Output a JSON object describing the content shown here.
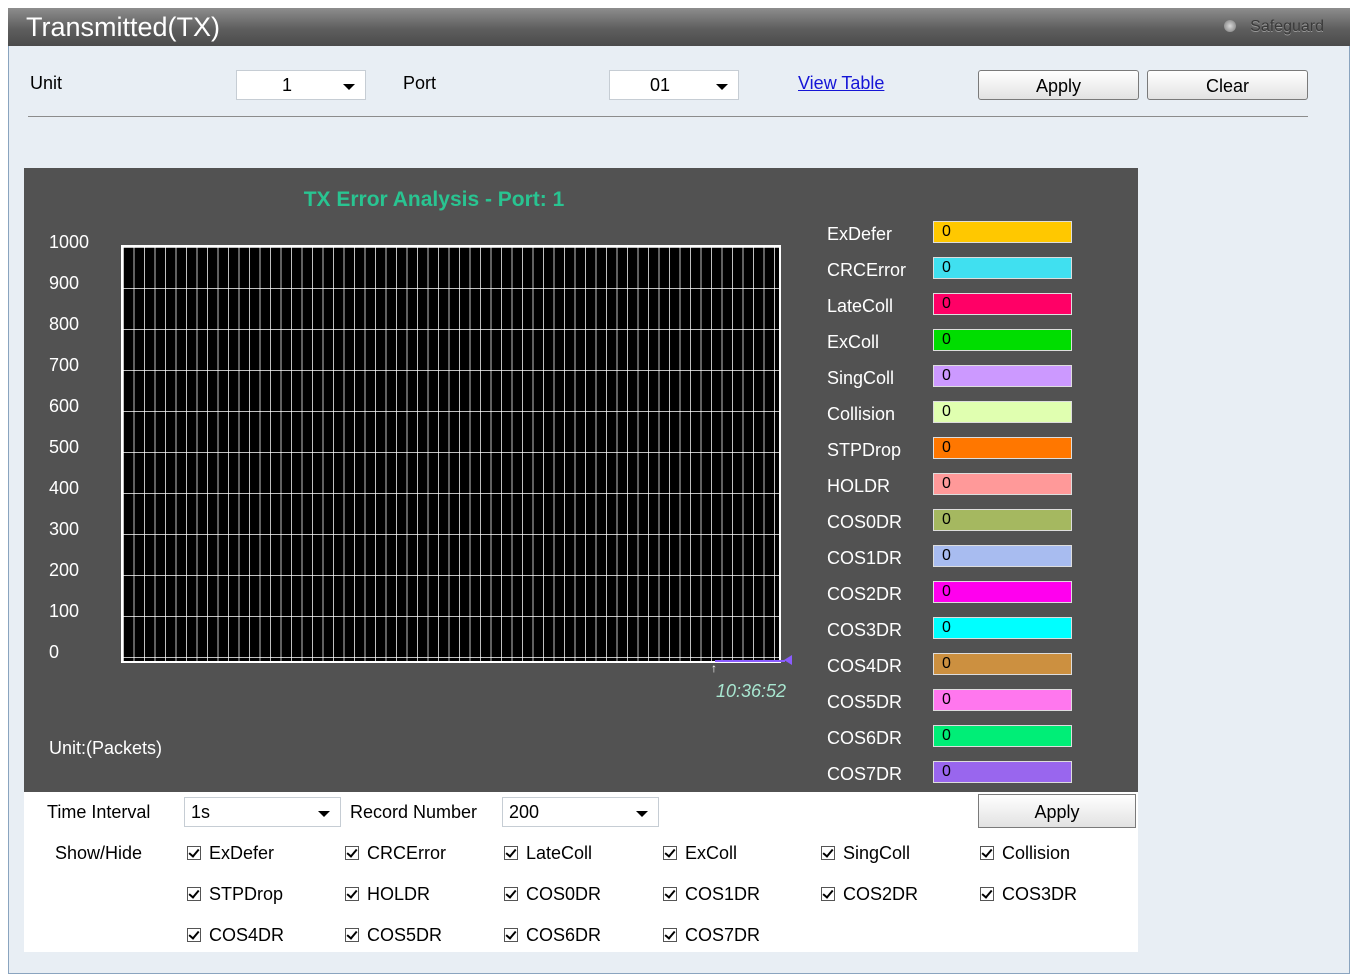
{
  "window": {
    "title": "Transmitted(TX)",
    "safeguard_label": "Safeguard"
  },
  "filters": {
    "unit_label": "Unit",
    "unit_value": "1",
    "port_label": "Port",
    "port_value": "01",
    "view_table_label": "View Table",
    "apply_label": "Apply",
    "clear_label": "Clear"
  },
  "chart": {
    "title": "TX Error Analysis - Port: 1",
    "unit_label": "Unit:(Packets)",
    "timestamp": "10:36:52",
    "y_ticks": [
      "1000",
      "900",
      "800",
      "700",
      "600",
      "500",
      "400",
      "300",
      "200",
      "100",
      "0"
    ],
    "legend": [
      {
        "name": "ExDefer",
        "value": "0",
        "color": "#ffc800"
      },
      {
        "name": "CRCError",
        "value": "0",
        "color": "#40e0f0"
      },
      {
        "name": "LateColl",
        "value": "0",
        "color": "#ff0066"
      },
      {
        "name": "ExColl",
        "value": "0",
        "color": "#00dd00"
      },
      {
        "name": "SingColl",
        "value": "0",
        "color": "#cc99ff"
      },
      {
        "name": "Collision",
        "value": "0",
        "color": "#e0ffb0"
      },
      {
        "name": "STPDrop",
        "value": "0",
        "color": "#ff7700"
      },
      {
        "name": "HOLDR",
        "value": "0",
        "color": "#ff9999"
      },
      {
        "name": "COS0DR",
        "value": "0",
        "color": "#a5b860"
      },
      {
        "name": "COS1DR",
        "value": "0",
        "color": "#a8bcf0"
      },
      {
        "name": "COS2DR",
        "value": "0",
        "color": "#ff00ee"
      },
      {
        "name": "COS3DR",
        "value": "0",
        "color": "#00ffff"
      },
      {
        "name": "COS4DR",
        "value": "0",
        "color": "#cc9040"
      },
      {
        "name": "COS5DR",
        "value": "0",
        "color": "#ff77ee"
      },
      {
        "name": "COS6DR",
        "value": "0",
        "color": "#00ee77"
      },
      {
        "name": "COS7DR",
        "value": "0",
        "color": "#9966ee"
      }
    ]
  },
  "chart_data": {
    "type": "line",
    "title": "TX Error Analysis - Port: 1",
    "ylabel": "Unit:(Packets)",
    "ylim": [
      0,
      1000
    ],
    "y_ticks": [
      1000,
      900,
      800,
      700,
      600,
      500,
      400,
      300,
      200,
      100,
      0
    ],
    "x": [
      "10:36:52"
    ],
    "grid": true,
    "legend_position": "right",
    "series": [
      {
        "name": "ExDefer",
        "values": [
          0
        ]
      },
      {
        "name": "CRCError",
        "values": [
          0
        ]
      },
      {
        "name": "LateColl",
        "values": [
          0
        ]
      },
      {
        "name": "ExColl",
        "values": [
          0
        ]
      },
      {
        "name": "SingColl",
        "values": [
          0
        ]
      },
      {
        "name": "Collision",
        "values": [
          0
        ]
      },
      {
        "name": "STPDrop",
        "values": [
          0
        ]
      },
      {
        "name": "HOLDR",
        "values": [
          0
        ]
      },
      {
        "name": "COS0DR",
        "values": [
          0
        ]
      },
      {
        "name": "COS1DR",
        "values": [
          0
        ]
      },
      {
        "name": "COS2DR",
        "values": [
          0
        ]
      },
      {
        "name": "COS3DR",
        "values": [
          0
        ]
      },
      {
        "name": "COS4DR",
        "values": [
          0
        ]
      },
      {
        "name": "COS5DR",
        "values": [
          0
        ]
      },
      {
        "name": "COS6DR",
        "values": [
          0
        ]
      },
      {
        "name": "COS7DR",
        "values": [
          0
        ]
      }
    ]
  },
  "settings": {
    "time_interval_label": "Time Interval",
    "time_interval_value": "1s",
    "record_number_label": "Record Number",
    "record_number_value": "200",
    "apply_label": "Apply",
    "show_hide_label": "Show/Hide",
    "checkboxes": [
      {
        "label": "ExDefer",
        "checked": true
      },
      {
        "label": "CRCError",
        "checked": true
      },
      {
        "label": "LateColl",
        "checked": true
      },
      {
        "label": "ExColl",
        "checked": true
      },
      {
        "label": "SingColl",
        "checked": true
      },
      {
        "label": "Collision",
        "checked": true
      },
      {
        "label": "STPDrop",
        "checked": true
      },
      {
        "label": "HOLDR",
        "checked": true
      },
      {
        "label": "COS0DR",
        "checked": true
      },
      {
        "label": "COS1DR",
        "checked": true
      },
      {
        "label": "COS2DR",
        "checked": true
      },
      {
        "label": "COS3DR",
        "checked": true
      },
      {
        "label": "COS4DR",
        "checked": true
      },
      {
        "label": "COS5DR",
        "checked": true
      },
      {
        "label": "COS6DR",
        "checked": true
      },
      {
        "label": "COS7DR",
        "checked": true
      }
    ]
  }
}
